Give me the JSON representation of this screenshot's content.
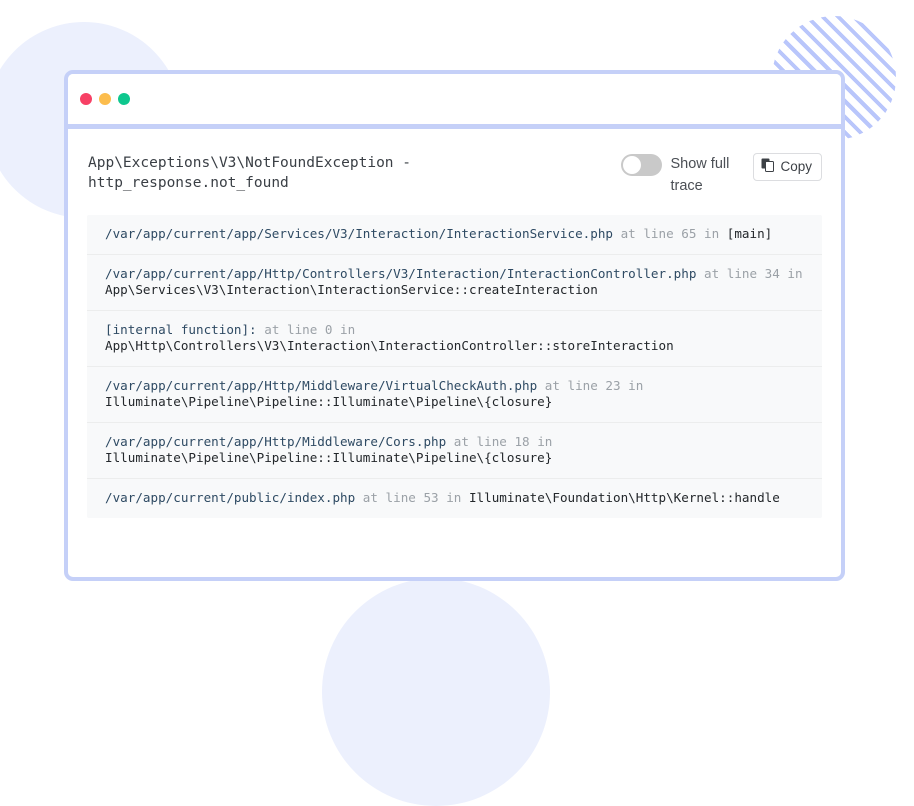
{
  "window": {
    "traffic_lights": [
      "close",
      "minimize",
      "maximize"
    ],
    "border_color": "#c5d0f8"
  },
  "header": {
    "exception_title": "App\\Exceptions\\V3\\NotFoundException -\nhttp_response.not_found",
    "toggle": {
      "label": "Show full trace",
      "state": "off"
    },
    "copy_button": {
      "label": "Copy",
      "icon": "copy-icon"
    }
  },
  "trace": {
    "rows": [
      {
        "file": "/var/app/current/app/Services/V3/Interaction/InteractionService.php",
        "meta": "at line 65 in",
        "fn": "[main]",
        "wrap": false
      },
      {
        "file": "/var/app/current/app/Http/Controllers/V3/Interaction/InteractionController.php",
        "meta": "at line 34 in",
        "fn": "App\\Services\\V3\\Interaction\\InteractionService::createInteraction",
        "wrap": true
      },
      {
        "file": "[internal function]:",
        "meta": "at line 0 in",
        "fn": "App\\Http\\Controllers\\V3\\Interaction\\InteractionController::storeInteraction",
        "wrap": true
      },
      {
        "file": "/var/app/current/app/Http/Middleware/VirtualCheckAuth.php",
        "meta": "at line 23 in",
        "fn": "Illuminate\\Pipeline\\Pipeline::Illuminate\\Pipeline\\{closure}",
        "wrap": true
      },
      {
        "file": "/var/app/current/app/Http/Middleware/Cors.php",
        "meta": "at line 18 in",
        "fn": "Illuminate\\Pipeline\\Pipeline::Illuminate\\Pipeline\\{closure}",
        "wrap": true
      },
      {
        "file": "/var/app/current/public/index.php",
        "meta": "at line 53 in",
        "fn": "Illuminate\\Foundation\\Http\\Kernel::handle",
        "wrap": false
      }
    ]
  },
  "decoration": {
    "soft_circle_color": "#ecf0fd",
    "hatch_color": "#b9c6fb"
  }
}
